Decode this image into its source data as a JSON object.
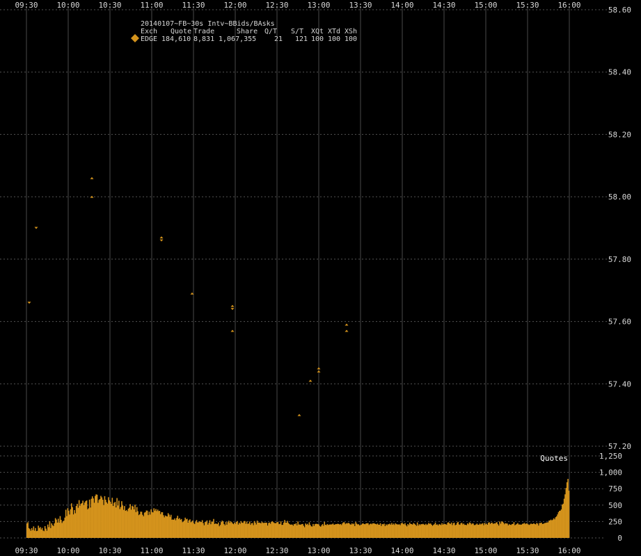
{
  "chart_data": {
    "type": "scatter",
    "title": "20140107~FB~30s Intv~BBids/BAsks",
    "x_ticks": [
      "09:30",
      "10:00",
      "10:30",
      "11:00",
      "11:30",
      "12:00",
      "12:30",
      "13:00",
      "13:30",
      "14:00",
      "14:30",
      "15:00",
      "15:30",
      "16:00"
    ],
    "x_range": [
      "09:30",
      "16:00"
    ],
    "price_axis": {
      "ylim": [
        57.2,
        58.6
      ],
      "ticks": [
        "58.60",
        "58.40",
        "58.20",
        "58.00",
        "57.80",
        "57.60",
        "57.40",
        "57.20"
      ],
      "grid": true
    },
    "legend": {
      "header": [
        "Exch",
        "Quote",
        "Trade",
        "Share",
        "Q/T",
        "S/T",
        "XQt",
        "XTd",
        "XSh"
      ],
      "rows": [
        [
          "EDGE",
          "184,610",
          "8,831",
          "1,067,355",
          "21",
          "121",
          "100",
          "100",
          "100"
        ]
      ],
      "color": "#d4931c",
      "placement": "top-left"
    },
    "series": [
      {
        "name": "EDGE",
        "color": "#d4931c",
        "points": [
          {
            "t": "09:32",
            "y": 57.66,
            "m": "ask"
          },
          {
            "t": "09:37",
            "y": 57.9,
            "m": "ask"
          },
          {
            "t": "10:17",
            "y": 58.06,
            "m": "bid"
          },
          {
            "t": "10:17",
            "y": 58.0,
            "m": "bid"
          },
          {
            "t": "11:07",
            "y": 57.87,
            "m": "bid"
          },
          {
            "t": "11:07",
            "y": 57.86,
            "m": "ask"
          },
          {
            "t": "11:29",
            "y": 57.69,
            "m": "bid"
          },
          {
            "t": "11:58",
            "y": 57.65,
            "m": "bid"
          },
          {
            "t": "11:58",
            "y": 57.64,
            "m": "ask"
          },
          {
            "t": "11:58",
            "y": 57.57,
            "m": "bid"
          },
          {
            "t": "12:46",
            "y": 57.3,
            "m": "bid"
          },
          {
            "t": "12:54",
            "y": 57.41,
            "m": "bid"
          },
          {
            "t": "13:00",
            "y": 57.45,
            "m": "bid"
          },
          {
            "t": "13:00",
            "y": 57.44,
            "m": "bid"
          },
          {
            "t": "13:20",
            "y": 57.59,
            "m": "bid"
          },
          {
            "t": "13:20",
            "y": 57.57,
            "m": "bid"
          }
        ]
      }
    ],
    "volume_panel": {
      "label": "Quotes",
      "ylim": [
        0,
        1250
      ],
      "ticks": [
        "1,250",
        "1,000",
        "750",
        "500",
        "250",
        "0"
      ],
      "values": [
        220,
        240,
        150,
        135,
        109,
        150,
        119,
        176,
        111,
        151,
        104,
        109,
        187,
        151,
        165,
        128,
        153,
        113,
        103,
        180,
        142,
        110,
        204,
        165,
        253,
        150,
        222,
        196,
        180,
        222,
        302,
        280,
        233,
        293,
        234,
        333,
        276,
        228,
        252,
        263,
        310,
        430,
        332,
        453,
        415,
        357,
        437,
        527,
        469,
        359,
        425,
        376,
        488,
        520,
        460,
        576,
        490,
        522,
        531,
        568,
        498,
        539,
        561,
        572,
        436,
        451,
        584,
        463,
        597,
        634,
        602,
        536,
        640,
        664,
        659,
        535,
        579,
        593,
        641,
        618,
        582,
        502,
        637,
        582,
        544,
        523,
        621,
        574,
        551,
        520,
        612,
        487,
        535,
        549,
        465,
        608,
        495,
        568,
        440,
        472,
        560,
        494,
        429,
        486,
        413,
        424,
        406,
        446,
        461,
        515,
        431,
        489,
        479,
        435,
        507,
        394,
        470,
        407,
        347,
        360,
        400,
        399,
        353,
        330,
        386,
        392,
        418,
        416,
        348,
        400,
        356,
        436,
        395,
        389,
        452,
        416,
        442,
        409,
        432,
        409,
        413,
        363,
        393,
        392,
        346,
        314,
        342,
        332,
        327,
        378,
        356,
        322,
        353,
        277,
        281,
        276,
        298,
        270,
        304,
        338,
        288,
        302,
        277,
        288,
        240,
        250,
        266,
        309,
        284,
        291,
        233,
        270,
        283,
        239,
        249,
        266,
        226,
        211,
        246,
        273,
        237,
        238,
        252,
        248,
        242,
        271,
        227,
        193,
        242,
        244,
        267,
        202,
        230,
        271,
        209,
        250,
        244,
        289,
        212,
        220,
        216,
        211,
        235,
        178,
        199,
        242,
        264,
        248,
        211,
        192,
        246,
        202,
        241,
        263,
        229,
        252,
        241,
        221,
        210,
        234,
        215,
        244,
        257,
        204,
        232,
        216,
        256,
        232,
        229,
        256,
        257,
        216,
        249,
        213,
        221,
        250,
        200,
        225,
        227,
        195,
        257,
        234,
        205,
        264,
        234,
        234,
        229,
        223,
        246,
        231,
        227,
        233,
        232,
        232,
        189,
        228,
        235,
        216,
        244,
        254,
        240,
        228,
        224,
        228,
        242,
        241,
        210,
        214,
        253,
        199,
        200,
        232,
        273,
        234,
        233,
        260,
        227,
        211,
        201,
        205,
        203,
        186,
        213,
        209,
        225,
        192,
        251,
        205,
        205,
        200,
        211,
        213,
        186,
        163,
        220,
        202,
        215,
        195,
        238,
        199,
        177,
        174,
        213,
        182,
        210,
        215,
        214,
        210,
        206,
        183,
        170,
        194,
        211,
        185,
        244,
        201,
        195,
        211,
        197,
        204,
        206,
        205,
        208,
        219,
        200,
        204,
        212,
        210,
        216,
        213,
        204,
        212,
        197,
        222,
        238,
        238,
        210,
        226,
        219,
        230,
        224,
        208,
        202,
        222,
        208,
        219,
        181,
        243,
        219,
        206,
        209,
        192,
        196,
        203,
        219,
        220,
        211,
        209,
        222,
        223,
        224,
        197,
        211,
        219,
        208,
        223,
        222,
        219,
        212,
        206,
        219,
        202,
        201,
        224,
        183,
        211,
        208,
        218,
        180,
        207,
        191,
        210,
        207,
        218,
        201,
        227,
        201,
        218,
        198,
        223,
        210,
        206,
        205,
        208,
        195,
        223,
        230,
        216,
        207,
        226,
        195,
        176,
        212,
        196,
        231,
        212,
        211,
        202,
        226,
        216,
        201,
        184,
        236,
        188,
        210,
        196,
        211,
        208,
        215,
        205,
        198,
        215,
        197,
        207,
        228,
        214,
        221,
        202,
        185,
        198,
        210,
        234,
        200,
        207,
        190,
        210,
        206,
        196,
        225,
        201,
        215,
        210,
        209,
        200,
        231,
        239,
        221,
        211,
        234,
        196,
        226,
        231,
        193,
        202,
        229,
        246,
        207,
        200,
        225,
        230,
        206,
        219,
        199,
        200,
        195,
        222,
        208,
        236,
        229,
        206,
        220,
        220,
        196,
        197,
        206,
        219,
        200,
        201,
        219,
        205,
        216,
        223,
        194,
        229,
        206,
        217,
        201,
        232,
        238,
        214,
        229,
        232,
        212,
        224,
        217,
        233,
        240,
        210,
        188,
        250,
        218,
        250,
        248,
        231,
        209,
        225,
        221,
        219,
        192,
        210,
        201,
        198,
        211,
        214,
        241,
        193,
        203,
        214,
        226,
        205,
        206,
        202,
        203,
        215,
        219,
        229,
        210,
        221,
        218,
        207,
        198,
        207,
        219,
        211,
        214,
        223,
        211,
        207,
        228,
        219,
        189,
        227,
        228,
        233,
        212,
        215,
        224,
        229,
        231,
        237,
        237,
        264,
        267,
        279,
        267,
        278,
        300,
        283,
        315,
        329,
        358,
        393,
        413,
        416,
        435,
        508,
        522,
        598,
        665,
        762,
        849,
        900,
        720
      ]
    }
  }
}
